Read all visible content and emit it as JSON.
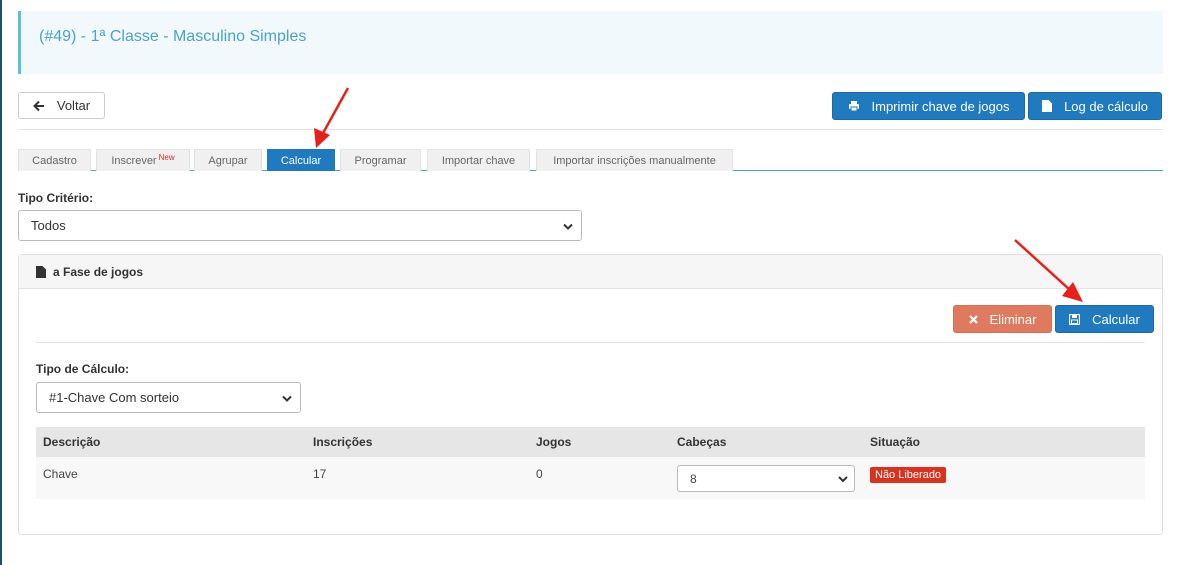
{
  "page": {
    "title": "(#49) - 1ª Classe - Masculino Simples"
  },
  "toolbar": {
    "back_label": "Voltar",
    "print_label": "Imprimir chave de jogos",
    "log_label": "Log de cálculo"
  },
  "tabs": [
    {
      "label": "Cadastro",
      "badge": ""
    },
    {
      "label": "Inscrever",
      "badge": "New"
    },
    {
      "label": "Agrupar",
      "badge": ""
    },
    {
      "label": "Calcular",
      "badge": "",
      "active": true
    },
    {
      "label": "Programar",
      "badge": ""
    },
    {
      "label": "Importar chave",
      "badge": ""
    },
    {
      "label": "Importar inscrições manualmente",
      "badge": ""
    }
  ],
  "criteria": {
    "label": "Tipo Critério:",
    "value": "Todos"
  },
  "panel": {
    "title": "a Fase de jogos",
    "delete_label": "Eliminar",
    "calc_label": "Calcular",
    "calc_type_label": "Tipo de Cálculo:",
    "calc_type_value": "#1-Chave Com sorteio"
  },
  "table": {
    "headers": [
      "Descrição",
      "Inscrições",
      "Jogos",
      "Cabeças",
      "Situação"
    ],
    "rows": [
      {
        "descricao": "Chave",
        "inscricoes": "17",
        "jogos": "0",
        "cabecas": "8",
        "situacao": "Não Liberado"
      }
    ]
  },
  "colors": {
    "primary": "#1f7ac0",
    "danger": "#e07a5f",
    "badge": "#d9321f",
    "annotation": "#e8201a"
  }
}
